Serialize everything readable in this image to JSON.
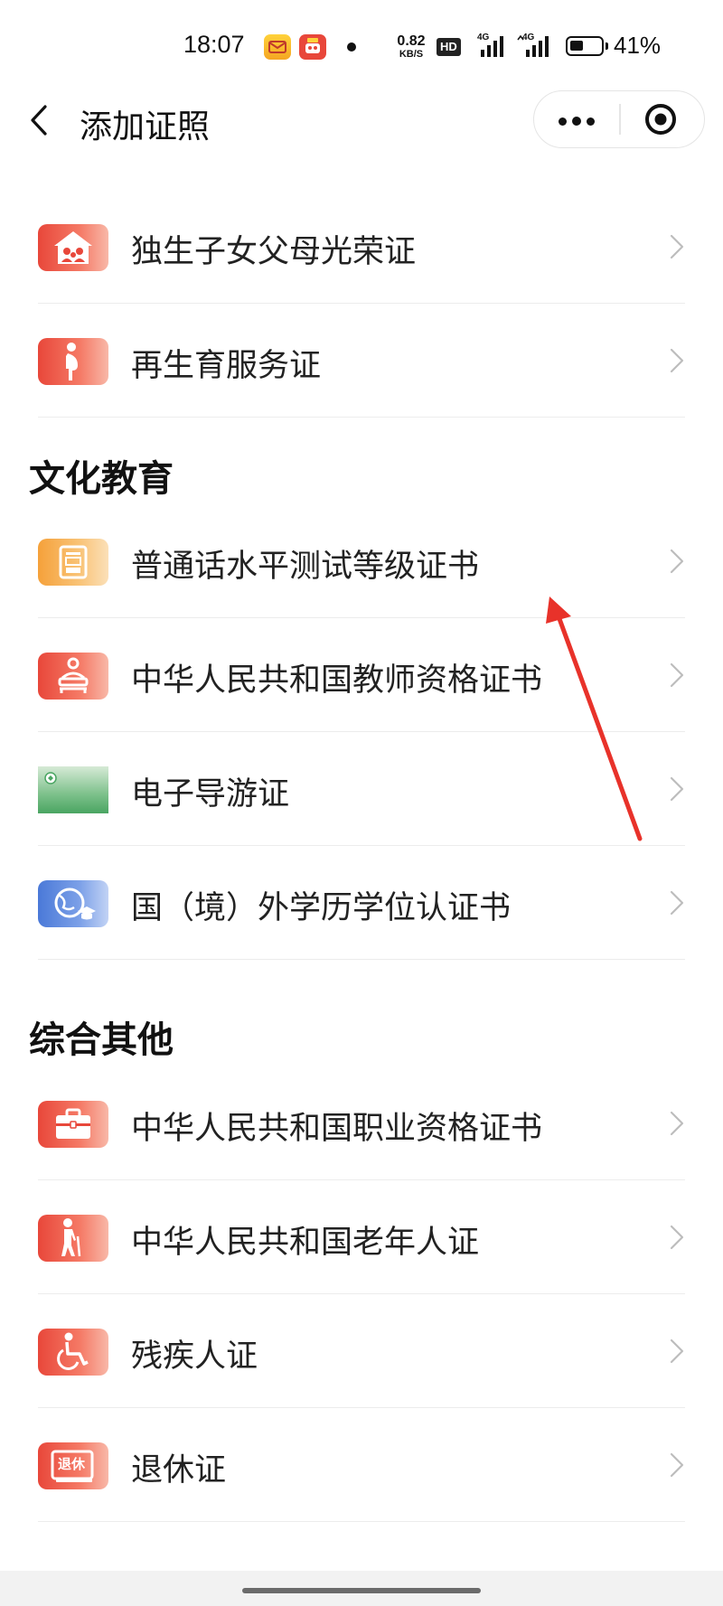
{
  "status_bar": {
    "time": "18:07",
    "net_speed_value": "0.82",
    "net_speed_unit": "KB/S",
    "hd_label": "HD",
    "sim1_label": "4G",
    "sim2_label": "4G",
    "battery_percent": "41%",
    "battery_level": 0.41
  },
  "nav": {
    "title": "添加证照",
    "more_icon": "more-dots-icon",
    "close_icon": "target-close-icon"
  },
  "sections": [
    {
      "title": "",
      "items": [
        {
          "label": "独生子女父母光荣证",
          "icon": "family-house-icon"
        },
        {
          "label": "再生育服务证",
          "icon": "pregnant-person-icon"
        }
      ]
    },
    {
      "title": "文化教育",
      "items": [
        {
          "label": "普通话水平测试等级证书",
          "icon": "mandarin-certificate-icon"
        },
        {
          "label": "中华人民共和国教师资格证书",
          "icon": "teacher-icon"
        },
        {
          "label": "电子导游证",
          "icon": "tour-guide-card-icon"
        },
        {
          "label": "国（境）外学历学位认证书",
          "icon": "globe-graduation-icon"
        }
      ]
    },
    {
      "title": "综合其他",
      "items": [
        {
          "label": "中华人民共和国职业资格证书",
          "icon": "briefcase-icon"
        },
        {
          "label": "中华人民共和国老年人证",
          "icon": "elderly-person-icon"
        },
        {
          "label": "残疾人证",
          "icon": "wheelchair-icon"
        },
        {
          "label": "退休证",
          "icon": "retirement-card-icon",
          "icon_text": "退休"
        }
      ]
    }
  ],
  "colors": {
    "red_icon": "#e8473a",
    "orange_icon": "#f5a13a",
    "green_icon": "#4aa562",
    "blue_icon": "#4a79d8",
    "annotation_arrow": "#e8322a"
  }
}
